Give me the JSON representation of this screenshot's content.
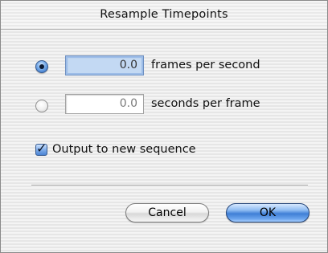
{
  "dialog": {
    "title": "Resample Timepoints"
  },
  "options": {
    "fps": {
      "selected": true,
      "value": "0.0",
      "label": "frames per second"
    },
    "spf": {
      "selected": false,
      "value": "0.0",
      "label": "seconds per frame"
    }
  },
  "output_new_sequence": {
    "checked": true,
    "label": "Output to new sequence"
  },
  "buttons": {
    "cancel_label": "Cancel",
    "ok_label": "OK"
  },
  "colors": {
    "accent_blue": "#3f7fd6",
    "field_selected_bg": "#c3d9f3"
  }
}
